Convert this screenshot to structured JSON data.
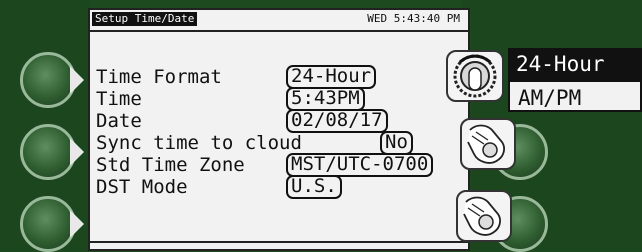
{
  "header": {
    "title": "Setup Time/Date",
    "datetime": "WED 5:43:40 PM"
  },
  "settings": [
    {
      "label": "Time Format",
      "value": "24-Hour"
    },
    {
      "label": "Time",
      "value": "5:43PM"
    },
    {
      "label": "Date",
      "value": "02/08/17"
    },
    {
      "label": "Sync time to cloud",
      "value": "No"
    },
    {
      "label": "Std Time Zone",
      "value": "MST/UTC-0700"
    },
    {
      "label": "DST Mode",
      "value": "U.S."
    }
  ],
  "popup": {
    "options": [
      "24-Hour",
      "AM/PM"
    ],
    "selected": "24-Hour"
  },
  "icons": {
    "knob": "rotary-knob-icon",
    "hand_press": "hand-press-icon"
  },
  "colors": {
    "bezel": "#1c471e",
    "screen": "#f2f2f2",
    "ink": "#111111",
    "button": "#2f5e31"
  }
}
